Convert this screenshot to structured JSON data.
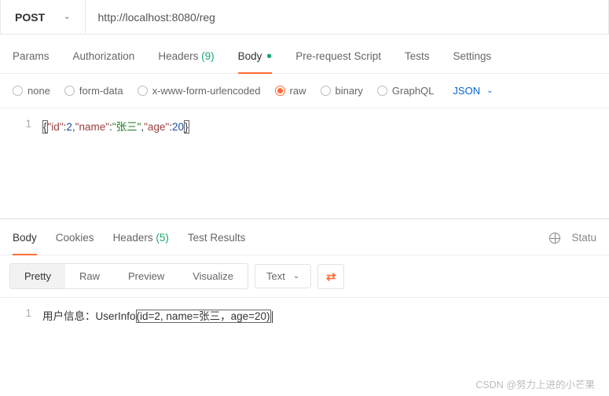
{
  "request": {
    "method": "POST",
    "url": "http://localhost:8080/reg",
    "tabs": {
      "params": "Params",
      "auth": "Authorization",
      "headers_label": "Headers",
      "headers_count": "(9)",
      "body": "Body",
      "prereq": "Pre-request Script",
      "tests": "Tests",
      "settings": "Settings"
    },
    "body_types": {
      "none": "none",
      "formdata": "form-data",
      "urlencoded": "x-www-form-urlencoded",
      "raw": "raw",
      "binary": "binary",
      "graphql": "GraphQL"
    },
    "raw_language": "JSON",
    "json_line": {
      "k1": "\"id\"",
      "v1": "2",
      "k2": "\"name\"",
      "v2": "\"张三\"",
      "k3": "\"age\"",
      "v3": "20"
    },
    "gutter1": "1"
  },
  "response": {
    "tabs": {
      "body": "Body",
      "cookies": "Cookies",
      "headers_label": "Headers",
      "headers_count": "(5)",
      "testresults": "Test Results"
    },
    "status_label": "Statu",
    "views": {
      "pretty": "Pretty",
      "raw": "Raw",
      "preview": "Preview",
      "visualize": "Visualize"
    },
    "content_type": "Text",
    "gutter1": "1",
    "body_prefix": "用户信息：UserInfo",
    "body_args": "(id=2, name=张三，age=20)"
  },
  "watermark": "CSDN @努力上进的小芒果"
}
